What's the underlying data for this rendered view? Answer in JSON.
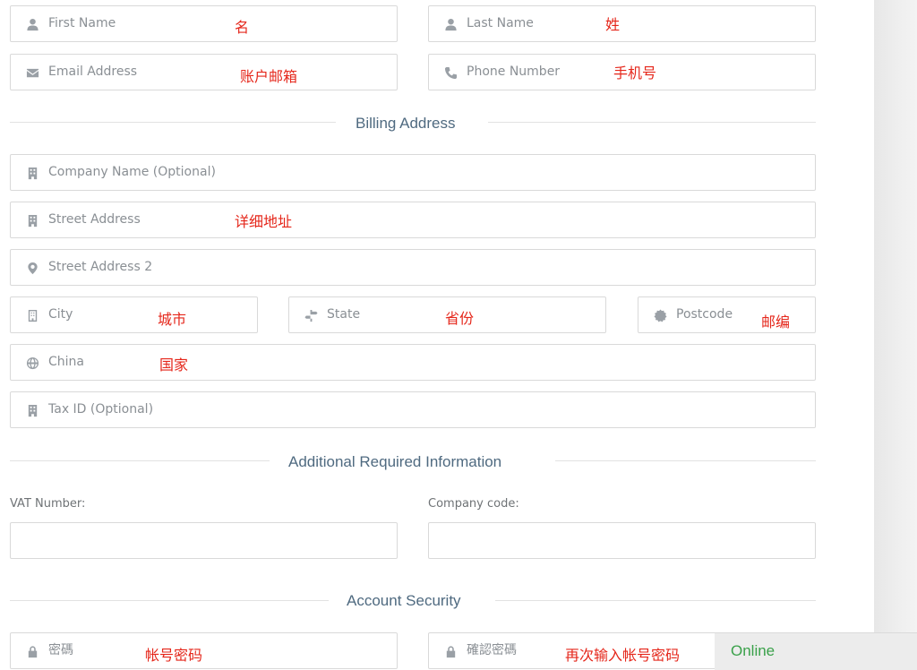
{
  "personal": {
    "first_name": {
      "placeholder": "First Name",
      "note": "名"
    },
    "last_name": {
      "placeholder": "Last Name",
      "note": "姓"
    },
    "email": {
      "placeholder": "Email Address",
      "note": "账户邮箱"
    },
    "phone": {
      "placeholder": "Phone Number",
      "note": "手机号"
    }
  },
  "billing": {
    "title": "Billing Address",
    "company": {
      "placeholder": "Company Name (Optional)"
    },
    "street": {
      "placeholder": "Street Address",
      "note": "详细地址"
    },
    "street2": {
      "placeholder": "Street Address 2"
    },
    "city": {
      "placeholder": "City",
      "note": "城市"
    },
    "state": {
      "placeholder": "State",
      "note": "省份"
    },
    "postcode": {
      "placeholder": "Postcode",
      "note": "邮编"
    },
    "country": {
      "value": "China",
      "note": "国家"
    },
    "tax_id": {
      "placeholder": "Tax ID (Optional)"
    }
  },
  "additional": {
    "title": "Additional Required Information",
    "vat_label": "VAT Number:",
    "company_code_label": "Company code:"
  },
  "security": {
    "title": "Account Security",
    "password": {
      "placeholder": "密碼",
      "note": "帐号密码"
    },
    "confirm": {
      "placeholder": "確認密碼",
      "note": "再次输入帐号密码"
    }
  },
  "chat": {
    "status": "Online"
  },
  "icons": [
    "user-icon",
    "envelope-icon",
    "phone-icon",
    "building-icon",
    "map-marker-icon",
    "signpost-icon",
    "certificate-icon",
    "globe-icon",
    "lock-icon"
  ]
}
